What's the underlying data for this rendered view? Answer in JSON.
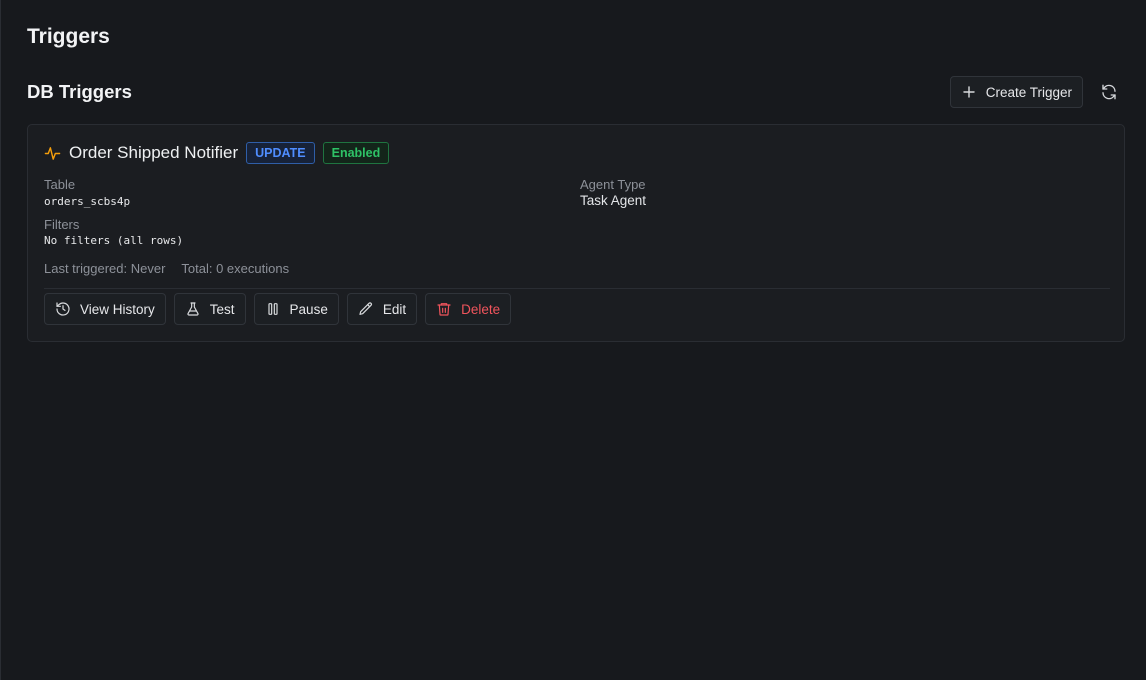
{
  "page": {
    "title": "Triggers"
  },
  "section": {
    "title": "DB Triggers",
    "create_label": "Create Trigger",
    "create_icon": "plus-icon",
    "refresh_icon": "refresh-icon"
  },
  "trigger": {
    "icon": "activity-pulse-icon",
    "name": "Order Shipped Notifier",
    "event_badge": "UPDATE",
    "status_badge": "Enabled",
    "table_label": "Table",
    "table_value": "orders_scbs4p",
    "agent_type_label": "Agent Type",
    "agent_type_value": "Task Agent",
    "filters_label": "Filters",
    "filters_value": "No filters (all rows)",
    "last_triggered": "Last triggered: Never",
    "total_executions": "Total: 0 executions",
    "actions": {
      "history": "View History",
      "test": "Test",
      "pause": "Pause",
      "edit": "Edit",
      "delete": "Delete"
    }
  },
  "colors": {
    "background": "#17191d",
    "card": "#1b1d21",
    "accent_blue": "#4f8dff",
    "enabled_green": "#2ec266",
    "danger_red": "#f0545c",
    "pulse_orange": "#f59e0b"
  }
}
